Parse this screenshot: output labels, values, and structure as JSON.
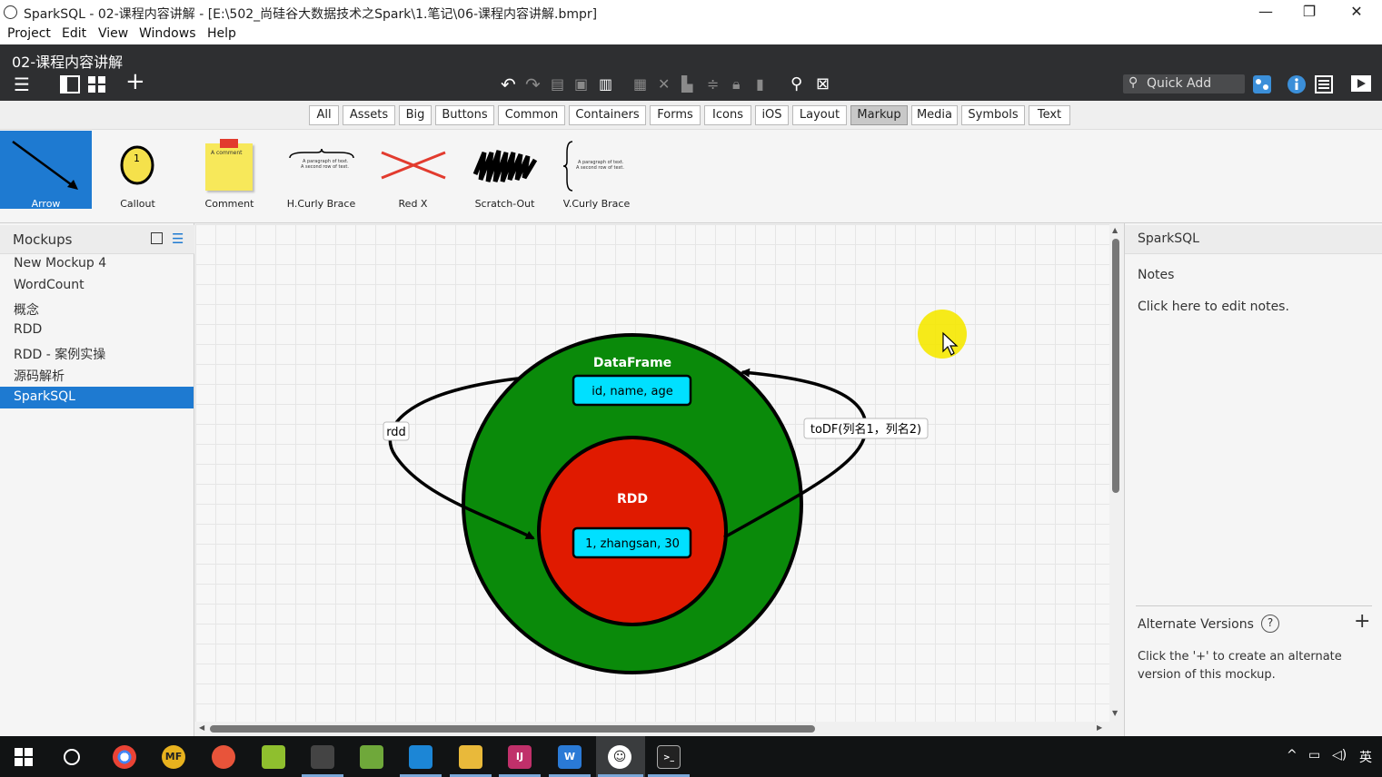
{
  "window": {
    "title": "SparkSQL - 02-课程内容讲解 - [E:\\502_尚硅谷大数据技术之Spark\\1.笔记\\06-课程内容讲解.bmpr]",
    "minimize": "—",
    "maximize": "❐",
    "close": "✕"
  },
  "menu": [
    "Project",
    "Edit",
    "View",
    "Windows",
    "Help"
  ],
  "toolbar": {
    "doc_title": "02-课程内容讲解",
    "quick_add_placeholder": "Quick Add"
  },
  "categories": [
    {
      "label": "All"
    },
    {
      "label": "Assets"
    },
    {
      "label": "Big"
    },
    {
      "label": "Buttons"
    },
    {
      "label": "Common"
    },
    {
      "label": "Containers"
    },
    {
      "label": "Forms"
    },
    {
      "label": "Icons"
    },
    {
      "label": "iOS"
    },
    {
      "label": "Layout"
    },
    {
      "label": "Markup",
      "active": true
    },
    {
      "label": "Media"
    },
    {
      "label": "Symbols"
    },
    {
      "label": "Text"
    }
  ],
  "library": {
    "items": [
      {
        "label": "Arrow",
        "icon": "arrow-icon",
        "active": true
      },
      {
        "label": "Callout",
        "icon": "callout-icon",
        "callout_number": "1"
      },
      {
        "label": "Comment",
        "icon": "comment-icon",
        "comment_text": "A comment"
      },
      {
        "label": "H.Curly Brace",
        "icon": "h-curly-brace-icon",
        "line1": "A paragraph of text.",
        "line2": "A second row of text."
      },
      {
        "label": "Red X",
        "icon": "red-x-icon"
      },
      {
        "label": "Scratch-Out",
        "icon": "scratch-out-icon"
      },
      {
        "label": "V.Curly Brace",
        "icon": "v-curly-brace-icon",
        "line1": "A paragraph of text.",
        "line2": "A second row of text."
      }
    ]
  },
  "mockups": {
    "title": "Mockups",
    "items": [
      {
        "label": "New Mockup 4"
      },
      {
        "label": "WordCount"
      },
      {
        "label": "概念"
      },
      {
        "label": "RDD"
      },
      {
        "label": "RDD - 案例实操"
      },
      {
        "label": "源码解析"
      },
      {
        "label": "SparkSQL",
        "active": true
      }
    ]
  },
  "diagram": {
    "outer_label": "DataFrame",
    "outer_box": "id, name, age",
    "inner_label": "RDD",
    "inner_box": "1, zhangsan, 30",
    "left_arrow_label": "rdd",
    "right_arrow_label": "toDF(列名1，列名2)",
    "outer_color": "#0a8a0a",
    "inner_color": "#e01a00",
    "box_color": "#00e0ff"
  },
  "rightpanel": {
    "title": "SparkSQL",
    "notes_label": "Notes",
    "notes_placeholder": "Click here to edit notes.",
    "alt_title": "Alternate Versions",
    "alt_help": "?",
    "alt_add": "+",
    "alt_desc1": "Click the '+' to create an alternate",
    "alt_desc2": "version of this mockup."
  },
  "taskbar": {
    "tray_lang": "英"
  }
}
